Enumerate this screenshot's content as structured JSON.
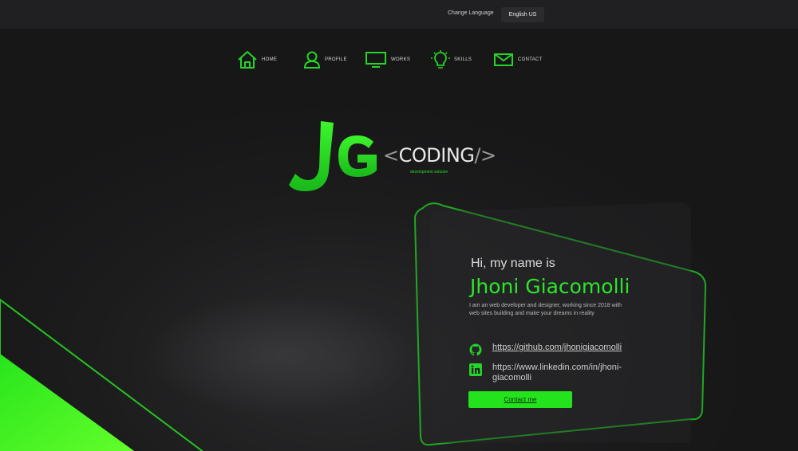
{
  "topbar": {
    "language_label": "Change Language",
    "language_value": "English US"
  },
  "nav": [
    {
      "label": "HOME",
      "icon": "home-icon"
    },
    {
      "label": "PROFILE",
      "icon": "user-icon"
    },
    {
      "label": "WORKS",
      "icon": "monitor-icon"
    },
    {
      "label": "SKILLS",
      "icon": "lightbulb-icon"
    },
    {
      "label": "CONTACT",
      "icon": "mail-icon"
    }
  ],
  "logo": {
    "mark": "JG",
    "word": "CODING",
    "open": "<",
    "close": "/>",
    "subtitle": "development solution"
  },
  "intro": {
    "greeting": "Hi, my name is",
    "name": "Jhoni Giacomolli",
    "bio": "I am an web developer and designer, working since 2018 with web sites building and make your dreams in reality",
    "github": "https://github.com/jhonigiacomolli",
    "linkedin": "https://www.linkedin.com/in/jhoni-giacomolli",
    "button": "Contact me"
  },
  "colors": {
    "accent": "#23e41c",
    "background": "#1b1b1c",
    "topbar": "#202022"
  }
}
